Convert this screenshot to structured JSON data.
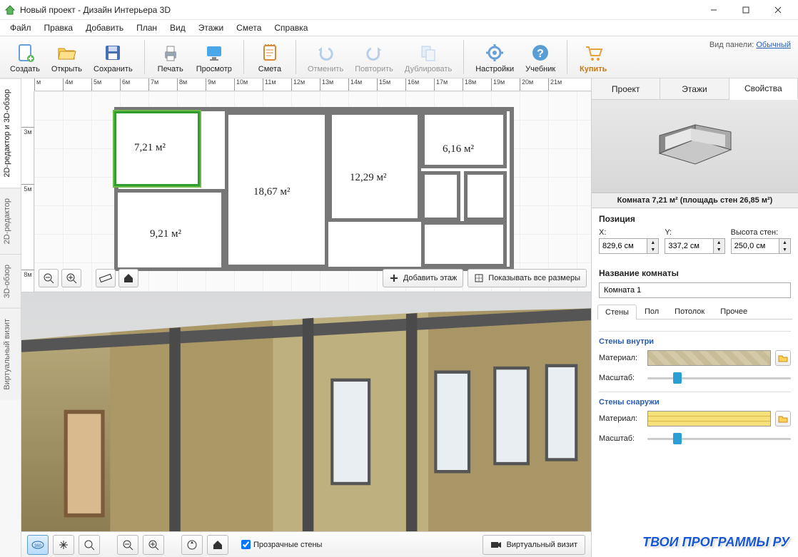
{
  "window": {
    "title": "Новый проект - Дизайн Интерьера 3D"
  },
  "menu": [
    "Файл",
    "Правка",
    "Добавить",
    "План",
    "Вид",
    "Этажи",
    "Смета",
    "Справка"
  ],
  "toolbar": {
    "create": "Создать",
    "open": "Открыть",
    "save": "Сохранить",
    "print": "Печать",
    "preview": "Просмотр",
    "estimate": "Смета",
    "undo": "Отменить",
    "redo": "Повторить",
    "duplicate": "Дублировать",
    "settings": "Настройки",
    "tutorial": "Учебник",
    "buy": "Купить",
    "panel_label": "Вид панели:",
    "panel_mode": "Обычный"
  },
  "side_tabs": [
    "2D-редактор и 3D-обзор",
    "2D-редактор",
    "3D-обзор",
    "Виртуальный визит"
  ],
  "ruler_h": [
    "м",
    "4м",
    "5м",
    "6м",
    "7м",
    "8м",
    "9м",
    "10м",
    "11м",
    "12м",
    "13м",
    "14м",
    "15м",
    "16м",
    "17м",
    "18м",
    "19м",
    "20м",
    "21м"
  ],
  "ruler_v": [
    "3м",
    "5м",
    "8м"
  ],
  "rooms": {
    "r1": "7,21 м²",
    "r2": "6,16 м²",
    "r3": "18,67 м²",
    "r4": "12,29 м²",
    "r5": "9,21 м²"
  },
  "plan_actions": {
    "add_floor": "Добавить этаж",
    "show_sizes": "Показывать все размеры"
  },
  "bottom": {
    "transparent": "Прозрачные стены",
    "vvisit": "Виртуальный визит"
  },
  "right": {
    "tabs": [
      "Проект",
      "Этажи",
      "Свойства"
    ],
    "room_title": "Комната 7,21 м²  (площадь стен 26,85 м²)",
    "position": "Позиция",
    "x_label": "X:",
    "y_label": "Y:",
    "h_label": "Высота стен:",
    "x": "829,6 см",
    "y": "337,2 см",
    "h": "250,0 см",
    "name_label": "Название комнаты",
    "name": "Комната 1",
    "subtabs": [
      "Стены",
      "Пол",
      "Потолок",
      "Прочее"
    ],
    "walls_in": "Стены внутри",
    "walls_out": "Стены снаружи",
    "material": "Материал:",
    "scale": "Масштаб:"
  },
  "watermark": "ТВОИ ПРОГРАММЫ РУ"
}
